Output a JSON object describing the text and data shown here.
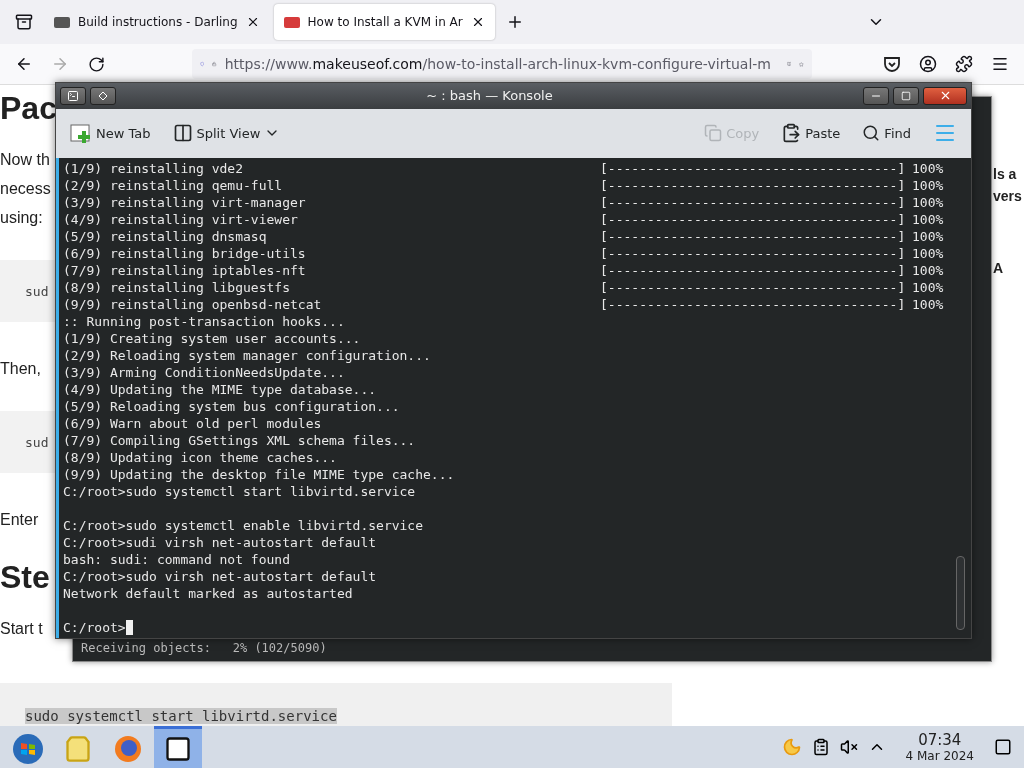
{
  "browser": {
    "tabs": [
      {
        "title": "Build instructions - Darling",
        "selected": false
      },
      {
        "title": "How to Install a KVM in Ar",
        "selected": true
      }
    ],
    "url": {
      "prefix": "https://www.",
      "host": "makeuseof.com",
      "path": "/how-to-install-arch-linux-kvm-configure-virtual-m"
    }
  },
  "page": {
    "left": [
      {
        "kind": "heading",
        "text": "Pac"
      },
      {
        "kind": "para",
        "lines": [
          "Now th",
          "necess",
          "using:"
        ]
      },
      {
        "kind": "code",
        "text": "sud"
      },
      {
        "kind": "para",
        "lines": [
          "Then,"
        ]
      },
      {
        "kind": "code",
        "text": "sud"
      },
      {
        "kind": "para",
        "lines": [
          "Enter"
        ]
      },
      {
        "kind": "heading",
        "text": "Ste"
      },
      {
        "kind": "para",
        "lines": [
          "Start t"
        ]
      }
    ],
    "right": [
      "ls a",
      "vers",
      "A"
    ],
    "code_block": {
      "text": "sudo systemctl start libvirtd.service",
      "selected": true
    }
  },
  "background_window": {
    "status_line": "Receiving objects:   2% (102/5090)"
  },
  "konsole": {
    "title": "~ : bash — Konsole",
    "toolbar": [
      {
        "kind": "new-tab",
        "label": "New Tab",
        "disabled": false
      },
      {
        "kind": "split",
        "label": "Split View",
        "disabled": false
      },
      {
        "kind": "copy",
        "label": "Copy",
        "disabled": true
      },
      {
        "kind": "paste",
        "label": "Paste",
        "disabled": false
      },
      {
        "kind": "find",
        "label": "Find",
        "disabled": false
      }
    ],
    "lines": [
      {
        "kind": "progress",
        "text": "(1/9) reinstalling vde2",
        "bar": "[-------------------------------------]",
        "percent": "100%"
      },
      {
        "kind": "progress",
        "text": "(2/9) reinstalling qemu-full",
        "bar": "[-------------------------------------]",
        "percent": "100%"
      },
      {
        "kind": "progress",
        "text": "(3/9) reinstalling virt-manager",
        "bar": "[-------------------------------------]",
        "percent": "100%"
      },
      {
        "kind": "progress",
        "text": "(4/9) reinstalling virt-viewer",
        "bar": "[-------------------------------------]",
        "percent": "100%"
      },
      {
        "kind": "progress",
        "text": "(5/9) reinstalling dnsmasq",
        "bar": "[-------------------------------------]",
        "percent": "100%"
      },
      {
        "kind": "progress",
        "text": "(6/9) reinstalling bridge-utils",
        "bar": "[-------------------------------------]",
        "percent": "100%"
      },
      {
        "kind": "progress",
        "text": "(7/9) reinstalling iptables-nft",
        "bar": "[-------------------------------------]",
        "percent": "100%"
      },
      {
        "kind": "progress",
        "text": "(8/9) reinstalling libguestfs",
        "bar": "[-------------------------------------]",
        "percent": "100%"
      },
      {
        "kind": "progress",
        "text": "(9/9) reinstalling openbsd-netcat",
        "bar": "[-------------------------------------]",
        "percent": "100%"
      },
      {
        "kind": "text",
        "text": ":: Running post-transaction hooks..."
      },
      {
        "kind": "text",
        "text": "(1/9) Creating system user accounts..."
      },
      {
        "kind": "text",
        "text": "(2/9) Reloading system manager configuration..."
      },
      {
        "kind": "text",
        "text": "(3/9) Arming ConditionNeedsUpdate..."
      },
      {
        "kind": "text",
        "text": "(4/9) Updating the MIME type database..."
      },
      {
        "kind": "text",
        "text": "(5/9) Reloading system bus configuration..."
      },
      {
        "kind": "text",
        "text": "(6/9) Warn about old perl modules"
      },
      {
        "kind": "text",
        "text": "(7/9) Compiling GSettings XML schema files..."
      },
      {
        "kind": "text",
        "text": "(8/9) Updating icon theme caches..."
      },
      {
        "kind": "text",
        "text": "(9/9) Updating the desktop file MIME type cache..."
      },
      {
        "kind": "text",
        "text": "C:/root>sudo systemctl start libvirtd.service"
      },
      {
        "kind": "blank"
      },
      {
        "kind": "text",
        "text": "C:/root>sudo systemctl enable libvirtd.service"
      },
      {
        "kind": "text",
        "text": "C:/root>sudi virsh net-autostart default"
      },
      {
        "kind": "text",
        "text": "bash: sudi: command not found"
      },
      {
        "kind": "text",
        "text": "C:/root>sudo virsh net-autostart default"
      },
      {
        "kind": "text",
        "text": "Network default marked as autostarted"
      },
      {
        "kind": "blank"
      },
      {
        "kind": "prompt",
        "text": "C:/root>"
      }
    ]
  },
  "taskbar": {
    "apps": [
      {
        "kind": "files",
        "active": false
      },
      {
        "kind": "firefox",
        "active": false
      },
      {
        "kind": "terminal",
        "active": true
      }
    ],
    "time": "07:34",
    "date": "4 Mar 2024"
  }
}
